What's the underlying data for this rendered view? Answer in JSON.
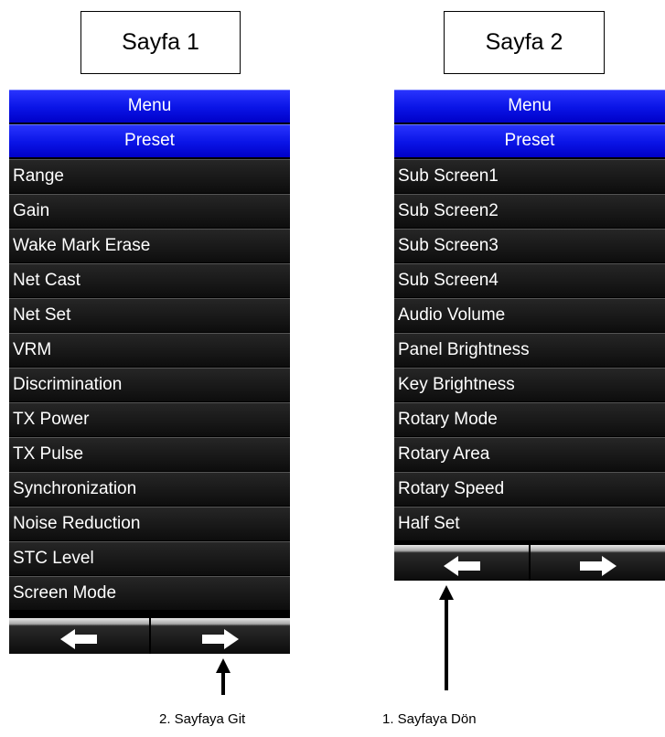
{
  "page1": {
    "title": "Sayfa 1",
    "header_menu": "Menu",
    "header_preset": "Preset",
    "items": [
      "Range",
      "Gain",
      "Wake Mark Erase",
      "Net Cast",
      "Net Set",
      "VRM",
      "Discrimination",
      "TX Power",
      "TX Pulse",
      "Synchronization",
      "Noise Reduction",
      "STC Level",
      "Screen Mode"
    ],
    "nav": {
      "left_icon": "arrow-left-icon",
      "right_icon": "arrow-right-icon"
    },
    "annotation": "2. Sayfaya Git"
  },
  "page2": {
    "title": "Sayfa 2",
    "header_menu": "Menu",
    "header_preset": "Preset",
    "items": [
      "Sub Screen1",
      "Sub Screen2",
      "Sub Screen3",
      "Sub Screen4",
      "Audio Volume",
      "Panel Brightness",
      "Key Brightness",
      "Rotary Mode",
      "Rotary Area",
      "Rotary Speed",
      "Half Set"
    ],
    "nav": {
      "left_icon": "arrow-left-icon",
      "right_icon": "arrow-right-icon"
    },
    "annotation": "1. Sayfaya Dön"
  },
  "colors": {
    "header_blue": "#0a14e6",
    "row_bg": "#111111",
    "text": "#ffffff"
  }
}
